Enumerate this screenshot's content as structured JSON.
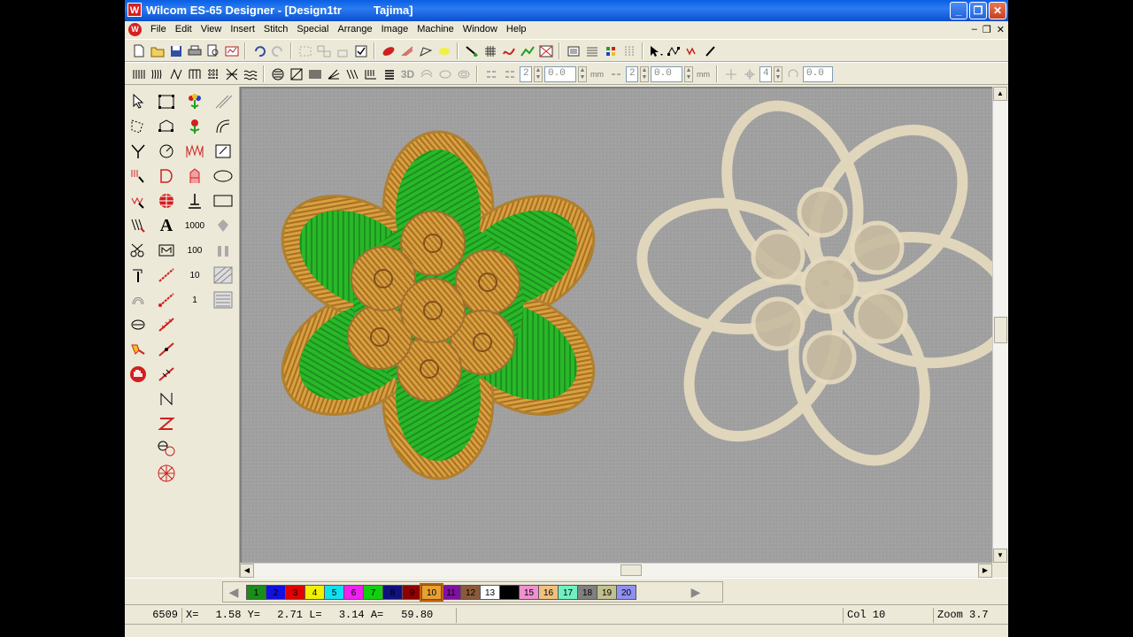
{
  "window": {
    "title": "Wilcom ES-65 Designer - [Design1tr          Tajima]",
    "logo_letter": "W",
    "minimize": "_",
    "maximize": "❐",
    "close": "✕"
  },
  "menu": {
    "items": [
      "File",
      "Edit",
      "View",
      "Insert",
      "Stitch",
      "Special",
      "Arrange",
      "Image",
      "Machine",
      "Window",
      "Help"
    ],
    "mdi_minimize": "–",
    "mdi_restore": "❐",
    "mdi_close": "✕"
  },
  "toolbar2": {
    "label_3d": "3D",
    "field1_value": "2",
    "field2_value": "0.0",
    "unit1": "mm",
    "field3_value": "2",
    "field4_value": "0.0",
    "unit2": "mm",
    "field5_value": "4",
    "field6_value": "0.0"
  },
  "toolbox": {
    "text_tool": "A",
    "counter_1000": "1000",
    "counter_100": "100",
    "counter_10": "10",
    "counter_1": "1"
  },
  "palette": {
    "prev": "◀",
    "next": "▶",
    "selected": "10",
    "swatches": [
      {
        "label": "1",
        "color": "#1a8c1a",
        "text": "#000"
      },
      {
        "label": "2",
        "color": "#1010e0",
        "text": "#000"
      },
      {
        "label": "3",
        "color": "#e00000",
        "text": "#000"
      },
      {
        "label": "4",
        "color": "#f0f000",
        "text": "#000"
      },
      {
        "label": "5",
        "color": "#10e0f0",
        "text": "#000"
      },
      {
        "label": "6",
        "color": "#f020f0",
        "text": "#000"
      },
      {
        "label": "7",
        "color": "#10d010",
        "text": "#000"
      },
      {
        "label": "8",
        "color": "#101080",
        "text": "#000"
      },
      {
        "label": "9",
        "color": "#900000",
        "text": "#000"
      },
      {
        "label": "10",
        "color": "#e8a030",
        "text": "#000"
      },
      {
        "label": "11",
        "color": "#8010a0",
        "text": "#000"
      },
      {
        "label": "12",
        "color": "#8a5a3a",
        "text": "#000"
      },
      {
        "label": "13",
        "color": "#ffffff",
        "text": "#000"
      },
      {
        "label": "14",
        "color": "#000000",
        "text": "#000"
      },
      {
        "label": "15",
        "color": "#f090d0",
        "text": "#000"
      },
      {
        "label": "16",
        "color": "#f0c080",
        "text": "#000"
      },
      {
        "label": "17",
        "color": "#70f0c0",
        "text": "#000"
      },
      {
        "label": "18",
        "color": "#808080",
        "text": "#000"
      },
      {
        "label": "19",
        "color": "#c0c090",
        "text": "#000"
      },
      {
        "label": "20",
        "color": "#9090f0",
        "text": "#000"
      }
    ]
  },
  "status": {
    "stitch_count": "6509",
    "x_label": "X=",
    "x_value": "1.58",
    "y_label": "Y=",
    "y_value": "2.71",
    "l_label": "L=",
    "l_value": "3.14",
    "a_label": "A=",
    "a_value": "59.80",
    "color": "Col 10",
    "zoom": "Zoom 3.7"
  },
  "colors": {
    "fabric": "#a0a0a0",
    "gold_thread": "#d8a040",
    "green_fill": "#28b828",
    "cream_thread": "#e8dcc0"
  }
}
